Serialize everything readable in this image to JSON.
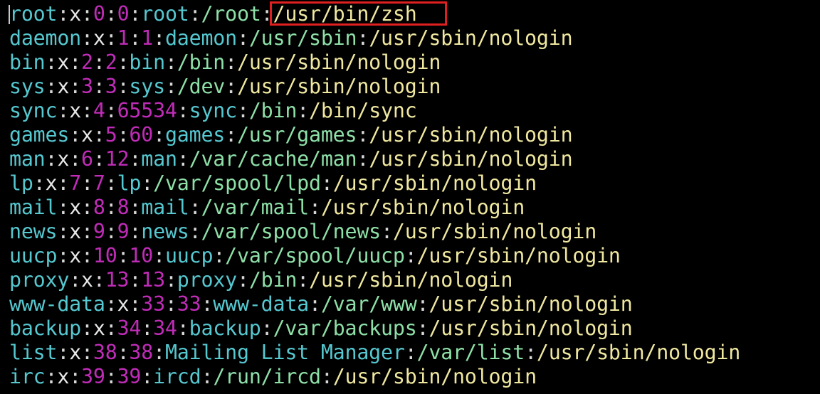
{
  "colors": {
    "background": "#000000",
    "user": "#56c8d0",
    "separator": "#d8d8d8",
    "password": "#e8e8e8",
    "uid": "#c02cb8",
    "gid": "#c02cb8",
    "gecos": "#56c8d0",
    "home": "#8ee0a8",
    "shell": "#f0e8a0",
    "highlight_border": "#e02020"
  },
  "highlight": {
    "target": "root-shell",
    "color": "#e02020"
  },
  "lines": [
    [
      "root",
      "x",
      "0",
      "0",
      "root",
      "/root",
      "/usr/bin/zsh"
    ],
    [
      "daemon",
      "x",
      "1",
      "1",
      "daemon",
      "/usr/sbin",
      "/usr/sbin/nologin"
    ],
    [
      "bin",
      "x",
      "2",
      "2",
      "bin",
      "/bin",
      "/usr/sbin/nologin"
    ],
    [
      "sys",
      "x",
      "3",
      "3",
      "sys",
      "/dev",
      "/usr/sbin/nologin"
    ],
    [
      "sync",
      "x",
      "4",
      "65534",
      "sync",
      "/bin",
      "/bin/sync"
    ],
    [
      "games",
      "x",
      "5",
      "60",
      "games",
      "/usr/games",
      "/usr/sbin/nologin"
    ],
    [
      "man",
      "x",
      "6",
      "12",
      "man",
      "/var/cache/man",
      "/usr/sbin/nologin"
    ],
    [
      "lp",
      "x",
      "7",
      "7",
      "lp",
      "/var/spool/lpd",
      "/usr/sbin/nologin"
    ],
    [
      "mail",
      "x",
      "8",
      "8",
      "mail",
      "/var/mail",
      "/usr/sbin/nologin"
    ],
    [
      "news",
      "x",
      "9",
      "9",
      "news",
      "/var/spool/news",
      "/usr/sbin/nologin"
    ],
    [
      "uucp",
      "x",
      "10",
      "10",
      "uucp",
      "/var/spool/uucp",
      "/usr/sbin/nologin"
    ],
    [
      "proxy",
      "x",
      "13",
      "13",
      "proxy",
      "/bin",
      "/usr/sbin/nologin"
    ],
    [
      "www-data",
      "x",
      "33",
      "33",
      "www-data",
      "/var/www",
      "/usr/sbin/nologin"
    ],
    [
      "backup",
      "x",
      "34",
      "34",
      "backup",
      "/var/backups",
      "/usr/sbin/nologin"
    ],
    [
      "list",
      "x",
      "38",
      "38",
      "Mailing List Manager",
      "/var/list",
      "/usr/sbin/nologin"
    ],
    [
      "irc",
      "x",
      "39",
      "39",
      "ircd",
      "/run/ircd",
      "/usr/sbin/nologin"
    ]
  ]
}
